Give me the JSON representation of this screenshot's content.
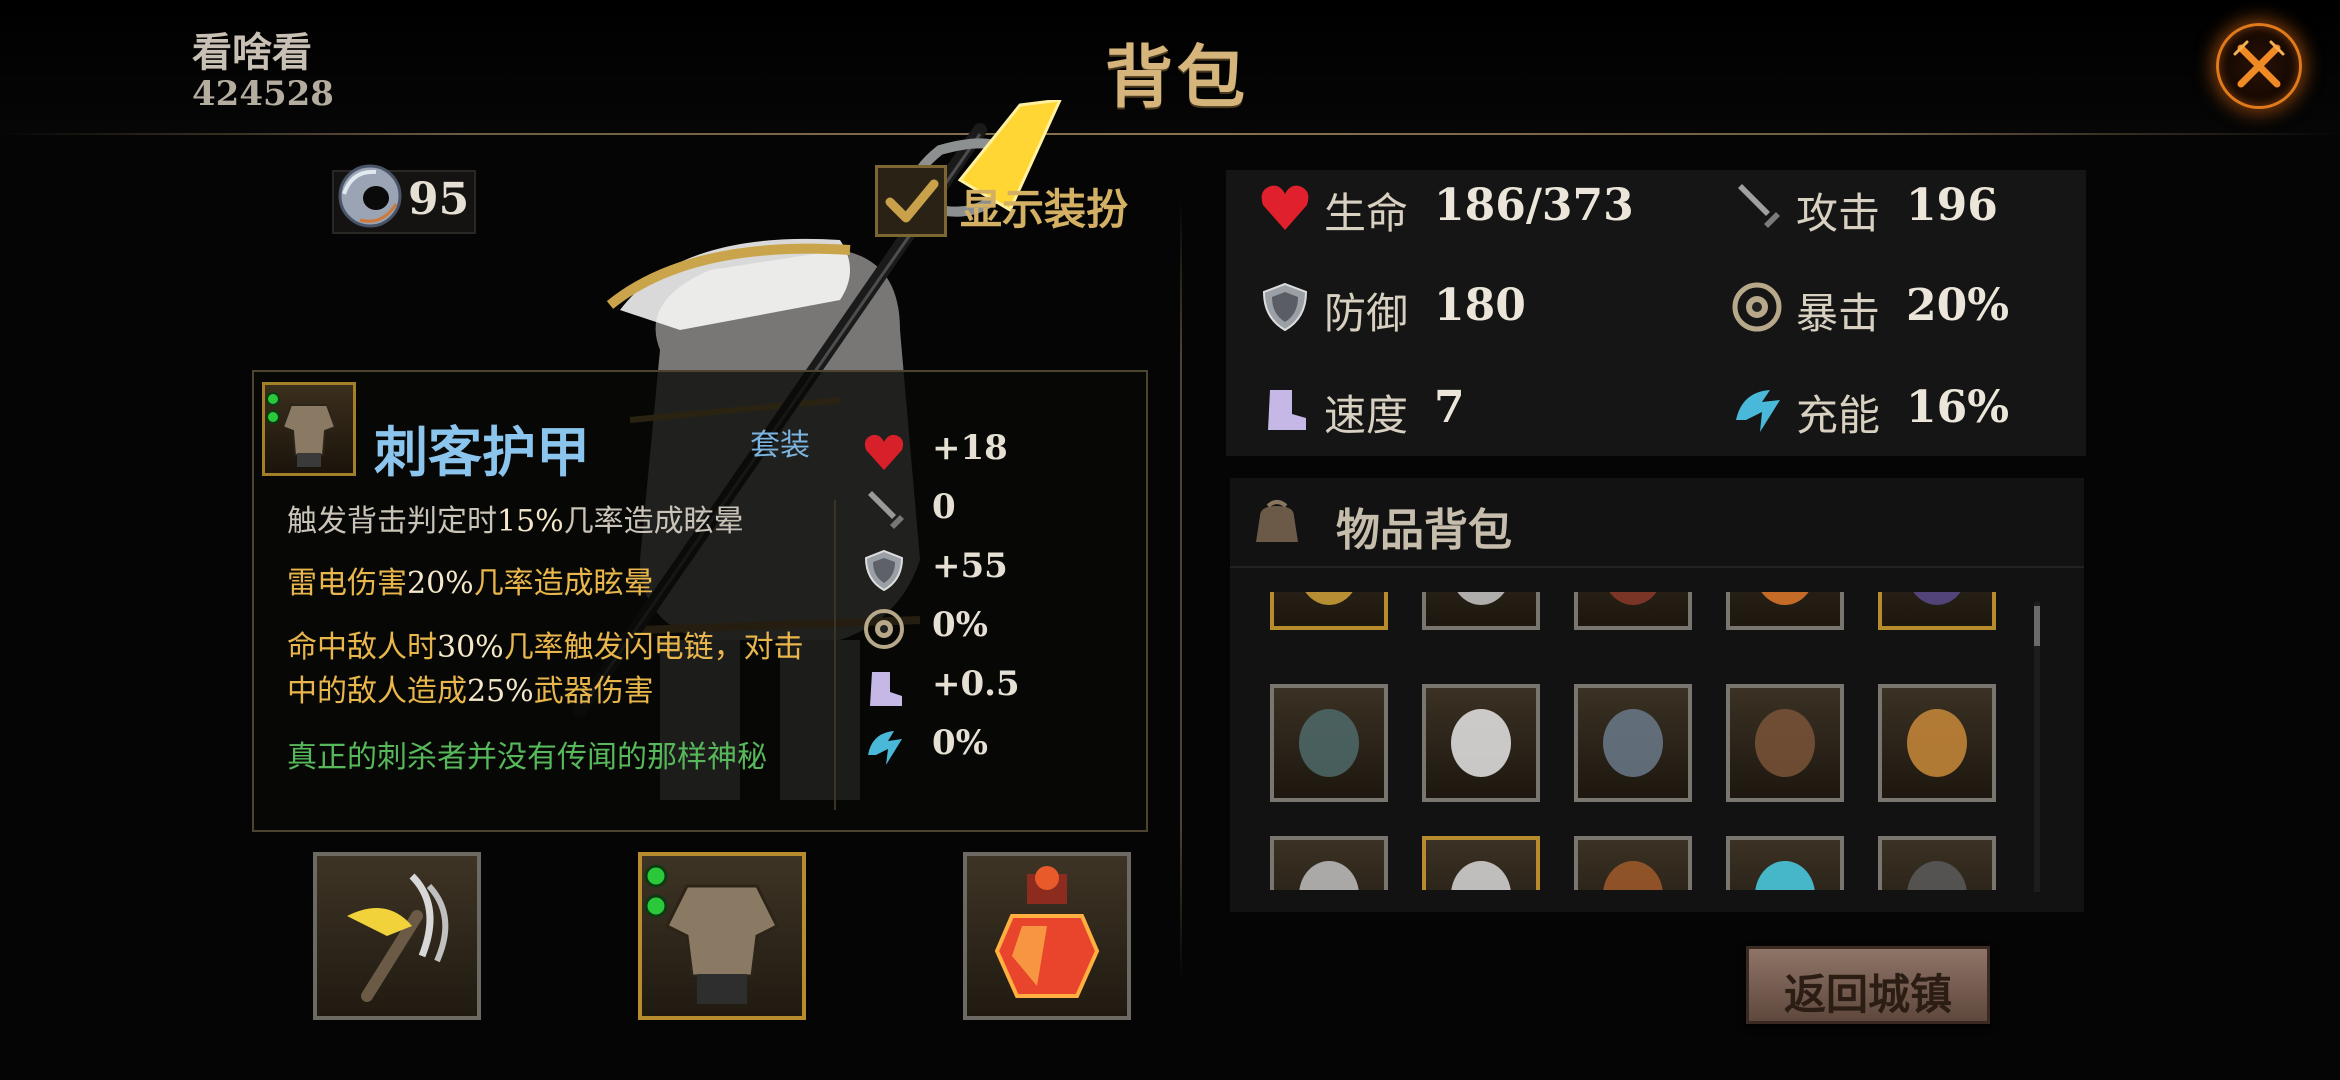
{
  "header": {
    "player_name": "看啥看",
    "player_id": "424528",
    "title": "背包"
  },
  "currency": {
    "value": "95"
  },
  "show_outfit": {
    "label": "显示装扮",
    "checked": true
  },
  "item": {
    "name": "刺客护甲",
    "set_tag": "套装",
    "descriptions": [
      {
        "parts": [
          "触发背击判定时",
          "15%",
          "几率造成眩晕"
        ],
        "color": "#c9c3b8"
      },
      {
        "parts": [
          "雷电伤害",
          "20%",
          "几率造成眩晕"
        ],
        "color": "#e8b64b"
      },
      {
        "parts": [
          "命中敌人时",
          "30%",
          "几率触发闪电链，对击中的敌人造成",
          "25%",
          "武器伤害"
        ],
        "color": "#e8b64b"
      },
      {
        "parts": [
          "真正的刺杀者并没有传闻的那样神秘"
        ],
        "color": "#56b85a"
      }
    ],
    "stats": [
      {
        "icon": "heart-icon",
        "value": "+18"
      },
      {
        "icon": "sword-icon",
        "value": "0"
      },
      {
        "icon": "shield-icon",
        "value": "+55"
      },
      {
        "icon": "crit-icon",
        "value": "0%"
      },
      {
        "icon": "boot-icon",
        "value": "+0.5"
      },
      {
        "icon": "energy-icon",
        "value": "0%"
      }
    ]
  },
  "equipment_slots": [
    {
      "name": "slot-weapon",
      "icon": "claw-weapon-icon"
    },
    {
      "name": "slot-armor",
      "icon": "armor-icon"
    },
    {
      "name": "slot-potion",
      "icon": "potion-icon"
    }
  ],
  "stats": {
    "hp": {
      "label": "生命",
      "value": "186/373",
      "icon": "heart-icon"
    },
    "attack": {
      "label": "攻击",
      "value": "196",
      "icon": "sword-icon"
    },
    "defense": {
      "label": "防御",
      "value": "180",
      "icon": "shield-icon"
    },
    "crit": {
      "label": "暴击",
      "value": "20%",
      "icon": "crit-icon"
    },
    "speed": {
      "label": "速度",
      "value": "7",
      "icon": "boot-icon"
    },
    "energy": {
      "label": "充能",
      "value": "16%",
      "icon": "energy-icon"
    }
  },
  "inventory": {
    "title": "物品背包",
    "icon": "bag-icon",
    "rows": [
      [
        "gold",
        "grey",
        "grey",
        "grey",
        "gold"
      ],
      [
        "grey",
        "grey",
        "grey",
        "grey",
        "grey"
      ],
      [
        "grey",
        "gold",
        "grey",
        "grey",
        "grey"
      ]
    ]
  },
  "return_button": {
    "label": "返回城镇"
  },
  "colors": {
    "title": "#d6b57d",
    "item_name": "#8bc4ec",
    "effect_text": "#e8b64b",
    "flavor_text": "#56b85a",
    "close_glow": "#e07a1a"
  }
}
